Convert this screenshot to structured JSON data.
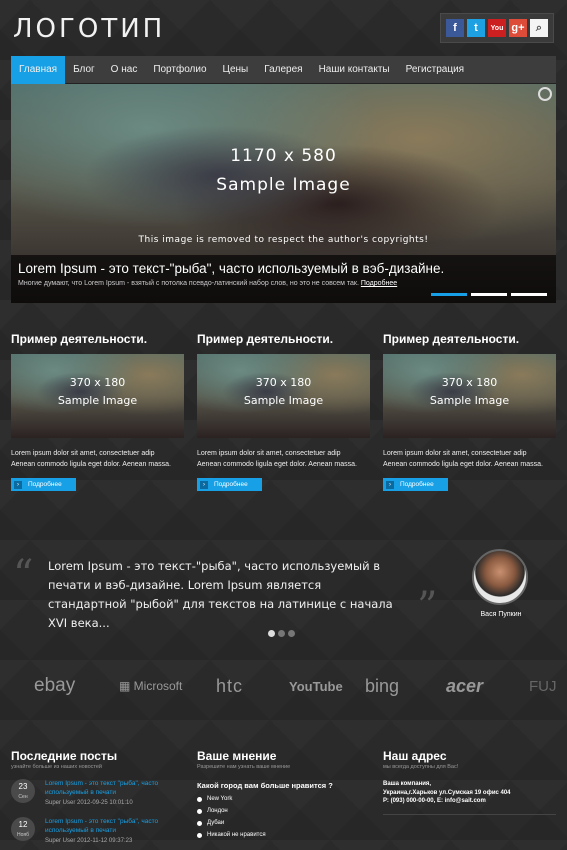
{
  "header": {
    "logo": "ЛОГОТИП",
    "social": [
      "f",
      "t",
      "You",
      "g+",
      "⌕"
    ]
  },
  "nav": {
    "items": [
      "Главная",
      "Блог",
      "О нас",
      "Портфолио",
      "Цены",
      "Галерея",
      "Наши контакты",
      "Регистрация"
    ],
    "active": "Главная"
  },
  "slider": {
    "size": "1170 x 580",
    "sample": "Sample Image",
    "copyright": "This image is removed to respect the author's copyrights!",
    "caption_title": "Lorem Ipsum - это текст-\"рыба\", часто используемый в вэб-дизайне.",
    "caption_text": "Многие думают, что Lorem Ipsum - взятый с потолка псевдо-латинский набор слов, но это не совсем так.",
    "caption_link": "Подробнее"
  },
  "features": [
    {
      "title": "Пример деятельности.",
      "size": "370 x 180",
      "sample": "Sample Image",
      "text1": "Lorem ipsum dolor sit amet, consectetuer adip",
      "text2": "Aenean commodo ligula eget dolor. Aenean massa.",
      "button": "Подробнее"
    },
    {
      "title": "Пример деятельности.",
      "size": "370 x 180",
      "sample": "Sample Image",
      "text1": "Lorem ipsum dolor sit amet, consectetuer adip",
      "text2": "Aenean commodo ligula eget dolor. Aenean massa.",
      "button": "Подробнее"
    },
    {
      "title": "Пример деятельности.",
      "size": "370 x 180",
      "sample": "Sample Image",
      "text1": "Lorem ipsum dolor sit amet, consectetuer adip",
      "text2": "Aenean commodo ligula eget dolor. Aenean massa.",
      "button": "Подробнее"
    }
  ],
  "testimonial": {
    "text": "Lorem Ipsum - это текст-\"рыба\", часто используемый в печати и вэб-дизайне. Lorem Ipsum является стандартной \"рыбой\" для текстов на латинице с начала XVI века...",
    "author": "Вася Пупкин"
  },
  "partners": [
    "ebay",
    "Microsoft",
    "htc",
    "YouTube",
    "bing",
    "acer",
    "FUJ"
  ],
  "footer": {
    "posts": {
      "title": "Последние посты",
      "subtitle": "узнайте больше из наших новостей",
      "items": [
        {
          "day": "23",
          "month": "Сен",
          "text": "Lorem Ipsum - это текст \"рыба\", часто используемый в печати",
          "meta": "Super User   2012-09-25 10:01:10"
        },
        {
          "day": "12",
          "month": "Нояб",
          "text": "Lorem Ipsum - это текст \"рыба\", часто используемый в печати",
          "meta": "Super User   2012-11-12 09:37:23"
        }
      ]
    },
    "poll": {
      "title": "Ваше мнение",
      "subtitle": "Разрешите нам узнать ваше мнение",
      "question": "Какой город вам больше нравится ?",
      "options": [
        "New York",
        "Лондон",
        "Дубаи",
        "Никакой не нравится"
      ]
    },
    "address": {
      "title": "Наш адрес",
      "subtitle": "мы всегда доступны для Вас!",
      "company": "Ваша компания,",
      "street": "Украина,г.Харьков ул.Сумская 19 офис 404",
      "phone": "Р: (093) 000-00-00, Е: info@sait.com"
    }
  }
}
